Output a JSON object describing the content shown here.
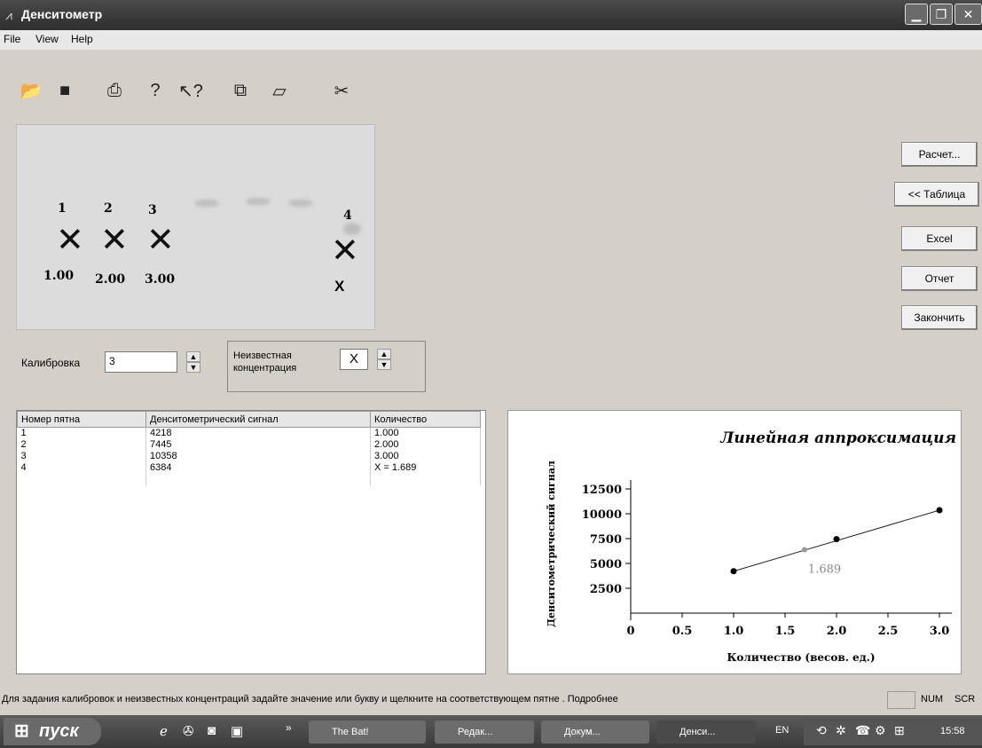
{
  "window": {
    "title": "Денситометр",
    "icon": "app-icon"
  },
  "menu": [
    "File",
    "View",
    "Help"
  ],
  "toolbar": [
    "open-icon",
    "save-icon",
    "print-icon",
    "help-icon",
    "context-help-icon",
    "copy-icon",
    "paste-icon",
    "scissors-icon"
  ],
  "gel": {
    "lanes": [
      {
        "number": "1",
        "value": "1.00"
      },
      {
        "number": "2",
        "value": "2.00"
      },
      {
        "number": "3",
        "value": "3.00"
      },
      {
        "number": "4",
        "value": "X"
      }
    ]
  },
  "buttons": {
    "calc": "Расчет...",
    "table": "<< Таблица",
    "excel": "Excel",
    "report": "Отчет",
    "finish": "Закончить"
  },
  "calibration": {
    "label": "Калибровка",
    "value": "3"
  },
  "unknown": {
    "label_line1": "Неизвестная",
    "label_line2": "концентрация",
    "value": "X"
  },
  "table": {
    "headers": [
      "Номер пятна",
      "Денситометрический сигнал",
      "Количество"
    ],
    "rows": [
      [
        "1",
        "4218",
        "1.000"
      ],
      [
        "2",
        "7445",
        "2.000"
      ],
      [
        "3",
        "10358",
        "3.000"
      ],
      [
        "4",
        "6384",
        "X = 1.689"
      ]
    ]
  },
  "chart_data": {
    "type": "scatter",
    "title": "Линейная аппроксимация",
    "xlabel": "Количество (весов. ед.)",
    "ylabel": "Денситометрический сигнал",
    "xlim": [
      0,
      3.0
    ],
    "ylim": [
      0,
      12500
    ],
    "xticks": [
      "0",
      "0.5",
      "1.0",
      "1.5",
      "2.0",
      "2.5",
      "3.0"
    ],
    "yticks": [
      "2500",
      "5000",
      "7500",
      "10000",
      "12500"
    ],
    "points": [
      {
        "x": 1.0,
        "y": 4218
      },
      {
        "x": 2.0,
        "y": 7445
      },
      {
        "x": 3.0,
        "y": 10358
      }
    ],
    "unknown_point": {
      "x": 1.689,
      "y": 6384,
      "label": "1.689"
    },
    "fit_line": [
      {
        "x": 1.0,
        "y": 4218
      },
      {
        "x": 3.0,
        "y": 10358
      }
    ]
  },
  "status": {
    "text": "Для задания калибровок и неизвестных концентраций задайте значение или букву и щелкните на соответствующем пятне . Подробнее",
    "num": "NUM",
    "scr": "SCR"
  },
  "taskbar": {
    "start": "пуск",
    "tasks": [
      "The Bat!",
      "Редак...",
      "Докум...",
      "Денси..."
    ],
    "lang": "EN",
    "clock": "15:58"
  }
}
